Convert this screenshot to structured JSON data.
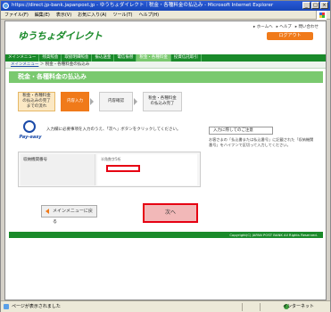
{
  "window": {
    "title": "https://direct.jp-bank.japanpost.jp - ゆうちょダイレクト｜税金・各種料金の払込み - Microsoft Internet Explorer"
  },
  "menubar": {
    "items": [
      "ファイル(F)",
      "編集(E)",
      "表示(V)",
      "お気に入り(A)",
      "ツール(T)",
      "ヘルプ(H)"
    ]
  },
  "header": {
    "logo": "ゆうちょダイレクト",
    "toplinks": [
      "▸ ホームへ",
      "▸ ヘルプ",
      "▸ 問い合わせ"
    ],
    "logout": "ログアウト"
  },
  "nav": {
    "items": [
      "メインメニュー",
      "残高照会",
      "取扱明細照会",
      "振込送金",
      "電信振替",
      "税金・各種料金",
      "投資信託取引"
    ],
    "active_index": 5
  },
  "breadcrumb": {
    "link": "メインメニュー",
    "rest": " ＞ 税金・各種料金の払込み"
  },
  "page": {
    "title": "税金・各種料金の払込み"
  },
  "steps": {
    "flow": "税金・各種料金\nの払込みの完了\nまでの流れ",
    "current": "内容入力",
    "confirm": "内容確認",
    "done": "税金・各種料金\nの払込み完了"
  },
  "payeasy": {
    "label": "Pay-easy"
  },
  "instruction": "入力欄に必要事項を入力のうえ、「次へ」ボタンをクリックしてください。",
  "note": {
    "title": "入力に際してのご注意",
    "text": "お客さまの「払込書または払込番号」に記載された「収納機関番号」をハイフンで区切って入力してください。"
  },
  "form": {
    "label": "収納機関番号",
    "hint": "半角数字5桁",
    "value": ""
  },
  "buttons": {
    "back": "メインメニューに戻る",
    "next": "次へ"
  },
  "footer": "Copyright(C) JAPAN POST BANK All Rights Reserved.",
  "status": {
    "text": "ページが表示されました",
    "zone": "インターネット"
  }
}
